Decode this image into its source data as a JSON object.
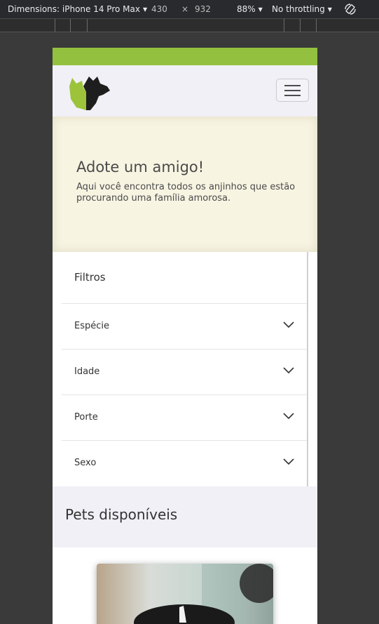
{
  "devtools": {
    "dimensions_label": "Dimensions: iPhone 14 Pro Max",
    "width": "430",
    "times": "×",
    "height": "932",
    "zoom": "88%",
    "throttle": "No throttling"
  },
  "site": {
    "hero": {
      "title": "Adote um amigo!",
      "subtitle": "Aqui você encontra todos os anjinhos que estão procurando uma família amorosa."
    },
    "filters": {
      "title": "Filtros",
      "items": [
        {
          "label": "Espécie"
        },
        {
          "label": "Idade"
        },
        {
          "label": "Porte"
        },
        {
          "label": "Sexo"
        }
      ]
    },
    "pets": {
      "title": "Pets disponíveis"
    }
  },
  "colors": {
    "accent_green": "#93c13f",
    "navbar_bg": "#f1f0f6",
    "hero_bg": "#f7f4e2"
  },
  "icons": [
    "chevron-down-icon",
    "menu-icon",
    "rotate-icon",
    "logo-cat-dog"
  ]
}
